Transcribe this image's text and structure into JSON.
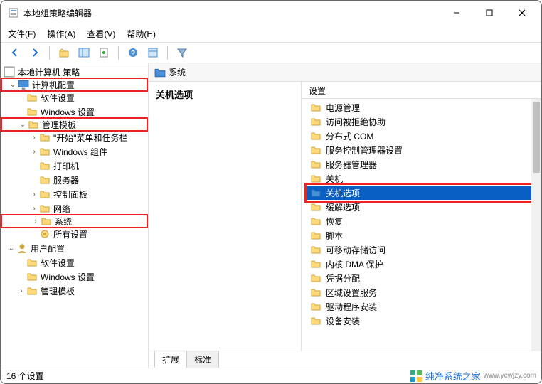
{
  "window": {
    "title": "本地组策略编辑器"
  },
  "menu": {
    "file": "文件(F)",
    "action": "操作(A)",
    "view": "查看(V)",
    "help": "帮助(H)"
  },
  "tree": {
    "root": "本地计算机 策略",
    "computer_config": "计算机配置",
    "software_settings_1": "软件设置",
    "windows_settings_1": "Windows 设置",
    "admin_templates_1": "管理模板",
    "start_menu": "\"开始\"菜单和任务栏",
    "windows_components": "Windows 组件",
    "printers": "打印机",
    "server": "服务器",
    "control_panel": "控制面板",
    "network": "网络",
    "system": "系统",
    "all_settings": "所有设置",
    "user_config": "用户配置",
    "software_settings_2": "软件设置",
    "windows_settings_2": "Windows 设置",
    "admin_templates_2": "管理模板"
  },
  "breadcrumb": {
    "label": "系统"
  },
  "left_heading": "关机选项",
  "list_header": "设置",
  "items": [
    {
      "label": "电源管理"
    },
    {
      "label": "访问被拒绝协助"
    },
    {
      "label": "分布式 COM"
    },
    {
      "label": "服务控制管理器设置"
    },
    {
      "label": "服务器管理器"
    },
    {
      "label": "关机"
    },
    {
      "label": "关机选项",
      "selected": true
    },
    {
      "label": "缓解选项"
    },
    {
      "label": "恢复"
    },
    {
      "label": "脚本"
    },
    {
      "label": "可移动存储访问"
    },
    {
      "label": "内核 DMA 保护"
    },
    {
      "label": "凭据分配"
    },
    {
      "label": "区域设置服务"
    },
    {
      "label": "驱动程序安装"
    },
    {
      "label": "设备安装"
    }
  ],
  "tabs": {
    "extended": "扩展",
    "standard": "标准"
  },
  "status": "16 个设置",
  "watermark": {
    "text": "纯净系统之家",
    "url": "www.ycwjzy.com"
  }
}
